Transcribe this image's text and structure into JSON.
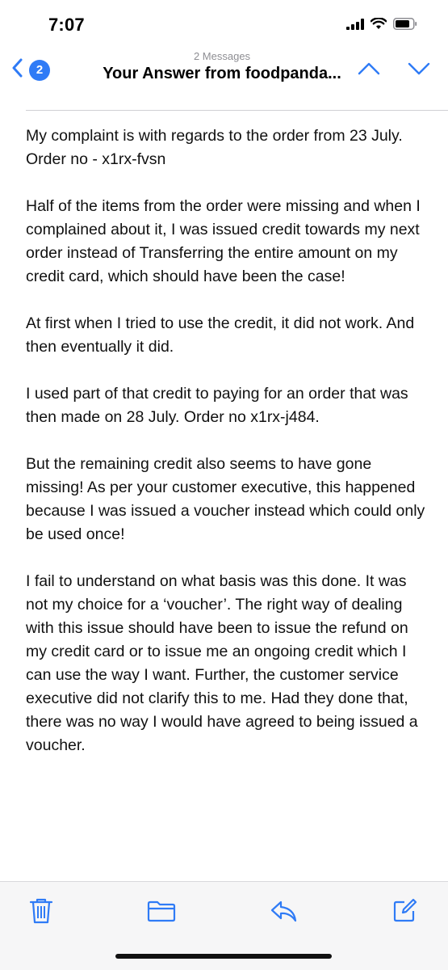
{
  "status_bar": {
    "time": "7:07"
  },
  "nav": {
    "back_count": "2",
    "subtitle": "2 Messages",
    "title": "Your Answer from foodpanda..."
  },
  "email": {
    "paragraphs": [
      "My complaint is with regards to the order from 23 July. Order no - x1rx-fvsn",
      "Half of the items from the order were missing and when I complained about it, I was issued credit towards my next order instead of Transferring the entire amount on my credit card, which should have been the case!",
      "At first when I tried to use the credit, it did not work. And then eventually it did.",
      "I used part of that credit to paying for an order that was then made on 28 July. Order no x1rx-j484.",
      "But the remaining credit also seems to have gone missing! As per your customer executive, this happened because I was issued a voucher instead which could only be used once!",
      "I fail to understand on what basis was this done. It was not my choice for a ‘voucher’. The right way of dealing with this issue should have been to issue the refund on my credit card or to issue me an ongoing credit which I can use the way I want. Further, the customer service executive did not clarify this to me. Had they done that, there was no way I would have agreed to being issued a voucher."
    ]
  },
  "toolbar": {
    "icons": [
      "trash-icon",
      "folder-icon",
      "reply-icon",
      "compose-icon"
    ]
  },
  "colors": {
    "accent": "#2f7bf6",
    "subtitle_gray": "#8e8e93"
  }
}
